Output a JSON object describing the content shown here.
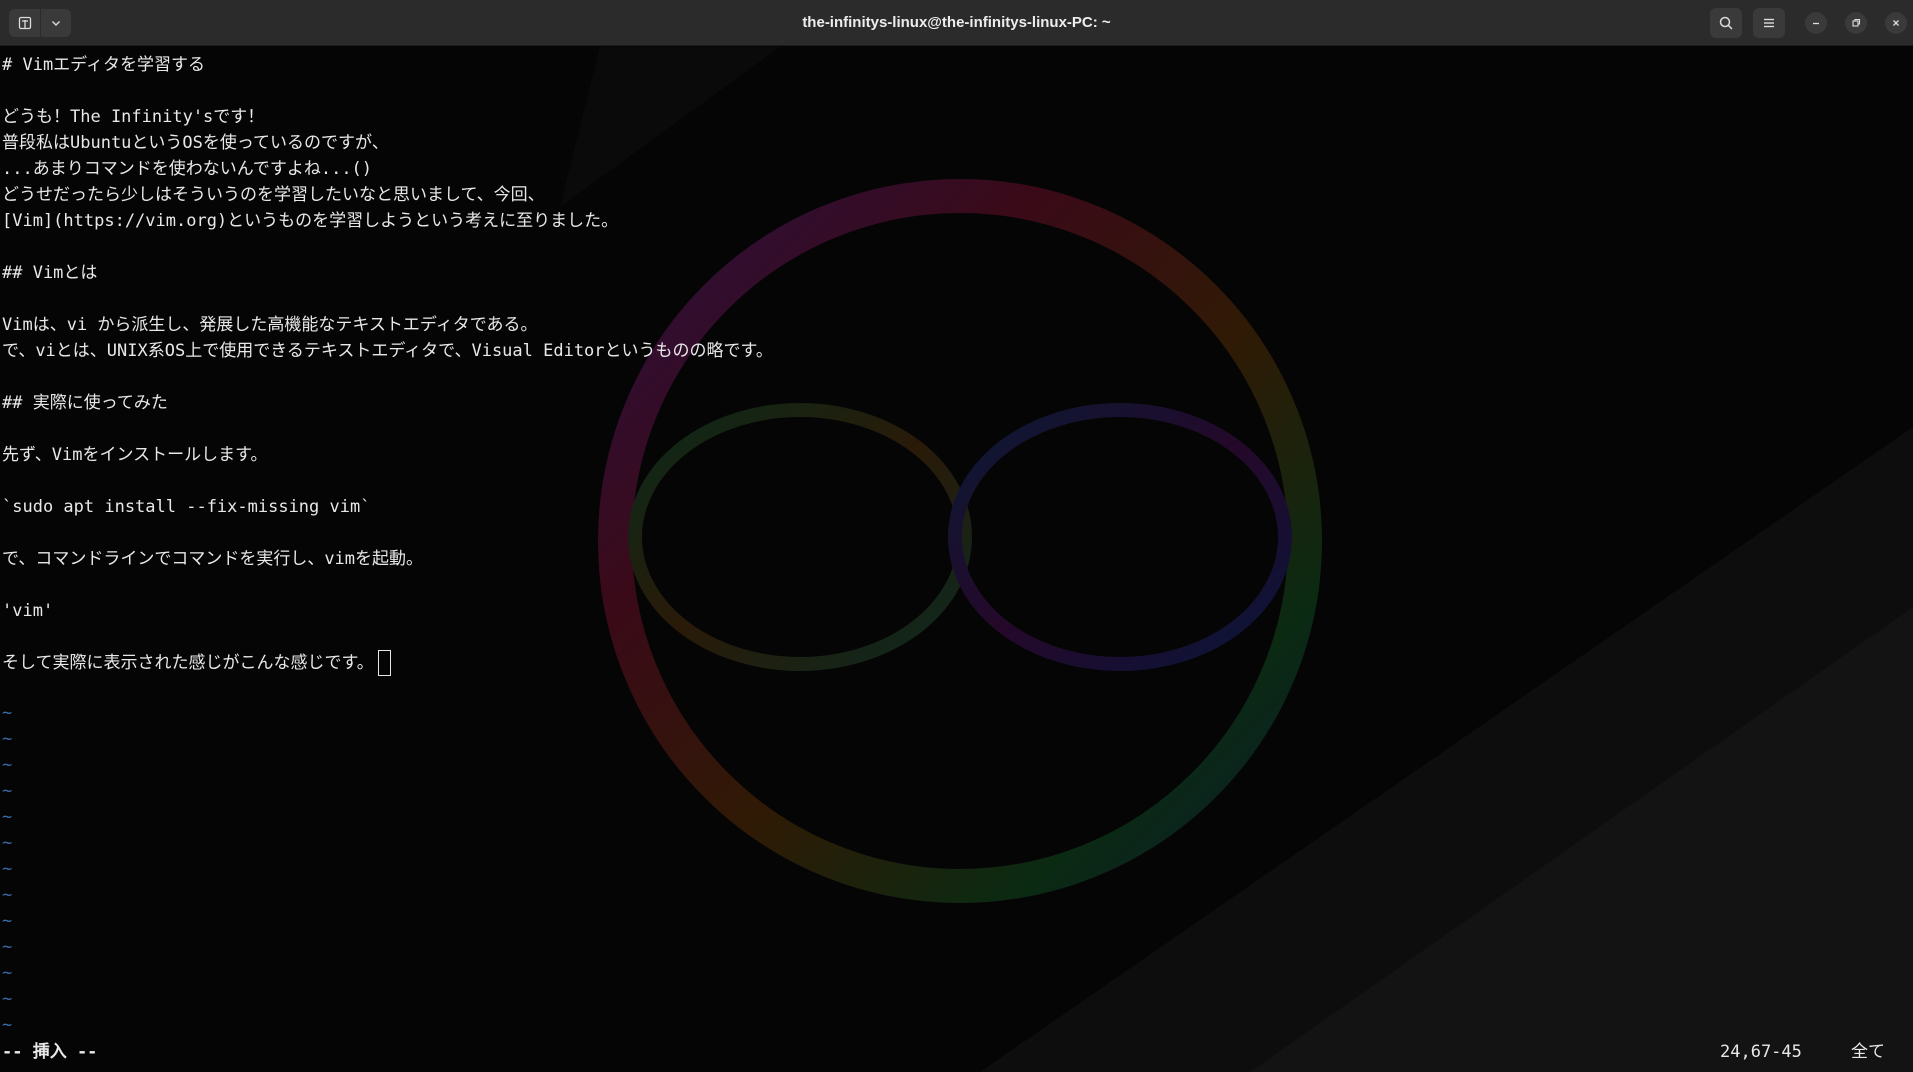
{
  "window": {
    "title": "the-infinitys-linux@the-infinitys-linux-PC: ~"
  },
  "icons": {
    "new_tab": "new-tab-icon",
    "tab_menu": "chevron-down-icon",
    "search": "search-icon",
    "menu": "hamburger-menu-icon",
    "minimize": "minimize-icon",
    "maximize": "maximize-icon",
    "close": "close-icon"
  },
  "editor": {
    "lines": [
      "# Vimエディタを学習する",
      "",
      "どうも！The Infinity'sです！",
      "普段私はUbuntuというOSを使っているのですが、",
      "...あまりコマンドを使わないんですよね...()",
      "どうせだったら少しはそういうのを学習したいなと思いまして、今回、",
      "[Vim](https://vim.org)というものを学習しようという考えに至りました。",
      "",
      "## Vimとは",
      "",
      "Vimは、vi から派生し、発展した高機能なテキストエディタである。",
      "で、viとは、UNIX系OS上で使用できるテキストエディタで、Visual Editorというものの略です。",
      "",
      "## 実際に使ってみた",
      "",
      "先ず、Vimをインストールします。",
      "",
      "`sudo apt install --fix-missing vim`",
      "",
      "で、コマンドラインでコマンドを実行し、vimを起動。",
      "",
      "'vim'",
      "",
      "そして実際に表示された感じがこんな感じです。"
    ],
    "empty_line_marker": "~",
    "empty_line_count": 13
  },
  "status": {
    "mode": "-- 挿入 --",
    "position": "24,67-45",
    "scroll": "全て"
  },
  "colors": {
    "titlebar": "#2b2b2b",
    "background": "#050505",
    "text": "#e8e8e8",
    "tilde": "#3b6aa8"
  }
}
